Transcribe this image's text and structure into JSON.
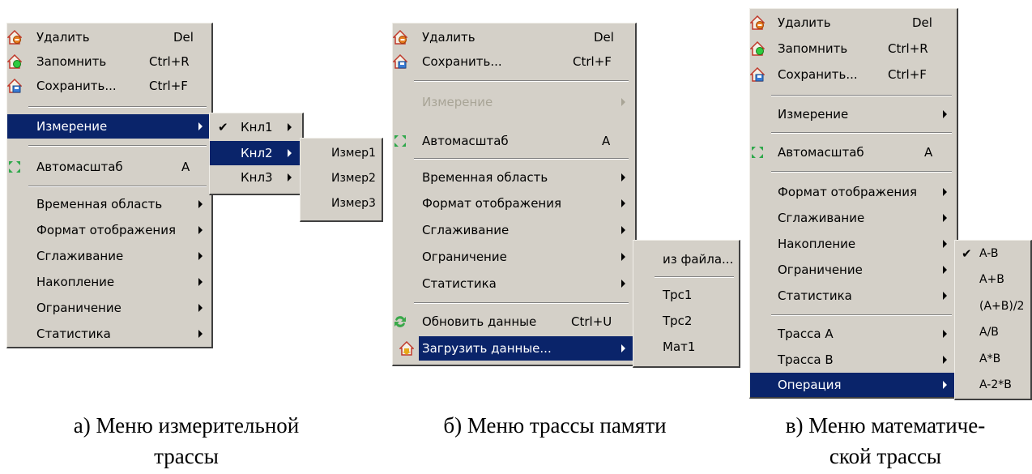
{
  "menu_a": {
    "items": {
      "delete": {
        "label": "Удалить",
        "shortcut": "Del"
      },
      "remember": {
        "label": "Запомнить",
        "shortcut": "Ctrl+R"
      },
      "save": {
        "label": "Сохранить...",
        "shortcut": "Ctrl+F"
      },
      "measure": {
        "label": "Измерение"
      },
      "autoscale": {
        "label": "Автомасштаб",
        "shortcut": "A"
      },
      "time_region": {
        "label": "Временная область"
      },
      "display_format": {
        "label": "Формат отображения"
      },
      "smoothing": {
        "label": "Сглаживание"
      },
      "accumulation": {
        "label": "Накопление"
      },
      "limit": {
        "label": "Ограничение"
      },
      "statistics": {
        "label": "Статистика"
      }
    },
    "channel_submenu": {
      "ch1": "Кнл1",
      "ch2": "Кнл2",
      "ch3": "Кнл3"
    },
    "measure_submenu": {
      "m1": "Измер1",
      "m2": "Измер2",
      "m3": "Измер3"
    },
    "caption_line1": "а) Меню измерительной",
    "caption_line2": "трассы"
  },
  "menu_b": {
    "items": {
      "delete": {
        "label": "Удалить",
        "shortcut": "Del"
      },
      "save": {
        "label": "Сохранить...",
        "shortcut": "Ctrl+F"
      },
      "measure": {
        "label": "Измерение"
      },
      "autoscale": {
        "label": "Автомасштаб",
        "shortcut": "A"
      },
      "time_region": {
        "label": "Временная область"
      },
      "display_format": {
        "label": "Формат отображения"
      },
      "smoothing": {
        "label": "Сглаживание"
      },
      "limit": {
        "label": "Ограничение"
      },
      "statistics": {
        "label": "Статистика"
      },
      "refresh": {
        "label": "Обновить данные",
        "shortcut": "Ctrl+U"
      },
      "load": {
        "label": "Загрузить данные..."
      }
    },
    "load_submenu": {
      "from_file": "из файла...",
      "trc1": "Трс1",
      "trc2": "Трс2",
      "mat1": "Мат1"
    },
    "caption": "б) Меню трассы памяти"
  },
  "menu_c": {
    "items": {
      "delete": {
        "label": "Удалить",
        "shortcut": "Del"
      },
      "remember": {
        "label": "Запомнить",
        "shortcut": "Ctrl+R"
      },
      "save": {
        "label": "Сохранить...",
        "shortcut": "Ctrl+F"
      },
      "measure": {
        "label": "Измерение"
      },
      "autoscale": {
        "label": "Автомасштаб",
        "shortcut": "A"
      },
      "display_format": {
        "label": "Формат отображения"
      },
      "smoothing": {
        "label": "Сглаживание"
      },
      "accumulation": {
        "label": "Накопление"
      },
      "limit": {
        "label": "Ограничение"
      },
      "statistics": {
        "label": "Статистика"
      },
      "trace_a": {
        "label": "Трасса А"
      },
      "trace_b": {
        "label": "Трасса В"
      },
      "operation": {
        "label": "Операция"
      }
    },
    "operation_submenu": {
      "a_minus_b": "A-B",
      "a_plus_b": "A+B",
      "avg": "(A+B)/2",
      "a_div_b": "A/B",
      "a_mul_b": "A*B",
      "a_minus_2b": "A-2*B"
    },
    "caption_line1": "в) Меню математиче-",
    "caption_line2": "ской трассы"
  },
  "icons": {
    "delete": "delete-icon",
    "remember": "remember-icon",
    "save": "save-icon",
    "autoscale": "autoscale-icon",
    "refresh": "refresh-icon",
    "load": "load-icon",
    "check": "check-icon",
    "submenu_arrow": "submenu-arrow-icon"
  },
  "colors": {
    "menu_bg": "#d4d0c8",
    "highlight": "#0a246a",
    "disabled": "#a8a496"
  }
}
